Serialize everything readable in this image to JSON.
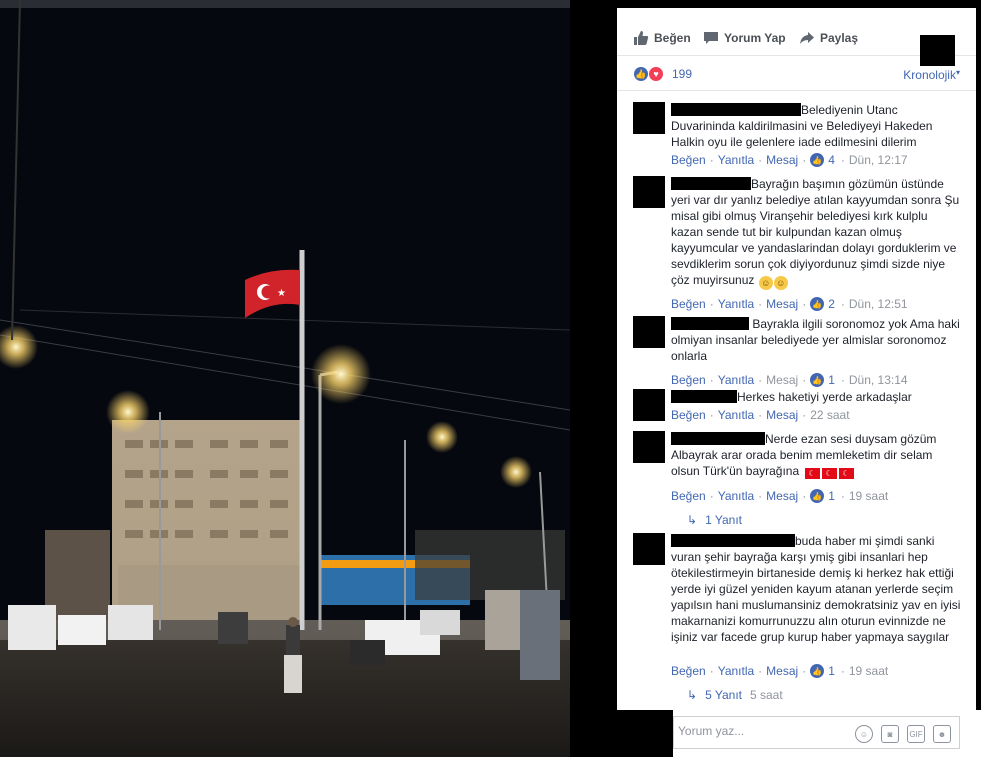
{
  "post": {
    "actions": [
      {
        "label": "Beğen",
        "icon": "thumbs-up-icon"
      },
      {
        "label": "Yorum Yap",
        "icon": "comment-icon"
      },
      {
        "label": "Paylaş",
        "icon": "share-icon"
      }
    ],
    "reaction_count": "199",
    "sort_label": "Kronolojik"
  },
  "comments": [
    {
      "text": "Belediyenin Utanc Duvarininda kaldirilmasini ve Belediyeyi Hakeden Halkin oyu ile gelenlere iade edilmesini dilerim",
      "like": "Beğen",
      "reply": "Yanıtla",
      "message": "Mesaj",
      "likes": "4",
      "time": "Dün, 12:17"
    },
    {
      "text": "Bayrağın başımın gözümün üstünde yeri var dır yanlız belediye atılan kayyumdan sonra Şu misal gibi olmuş Viranşehir belediyesi kırk kulplu kazan sende tut bir kulpundan kazan olmuş kayyumcular ve yandaslarindan dolayı gorduklerim ve sevdiklerim sorun çok diyiyordunuz şimdi sizde niye çöz muyirsunuz",
      "like": "Beğen",
      "reply": "Yanıtla",
      "message": "Mesaj",
      "likes": "2",
      "time": "Dün, 12:51"
    },
    {
      "text": "Bayrakla ilgili soronomoz yok Ama haki olmiyan insanlar belediyede yer almislar soronomoz onlarla",
      "like": "Beğen",
      "reply": "Yanıtla",
      "message": "Mesaj",
      "likes": "1",
      "time": "Dün, 13:14"
    },
    {
      "text": "Herkes haketiyi yerde arkadaşlar",
      "like": "Beğen",
      "reply": "Yanıtla",
      "message": "Mesaj",
      "time": "22 saat"
    },
    {
      "text": "Nerde ezan sesi duysam gözüm Albayrak arar orada benim memleketim dir selam olsun Türk'ün bayrağına",
      "like": "Beğen",
      "reply": "Yanıtla",
      "message": "Mesaj",
      "likes": "1",
      "time": "19 saat",
      "replies": "1 Yanıt"
    },
    {
      "text": "buda haber mi şimdi sanki vuran şehir bayrağa karşı ymiş gibi insanlari hep ötekilestirmeyin birtaneside demiş ki herkez hak ettiği yerde iyi güzel yeniden kayum atanan yerlerde seçim yapılsın hani muslumansiniz demokratsiniz yav en iyisi makarnanizi komurrunuzzu alın oturun evinnizde ne işiniz var facede grup kurup haber yapmaya saygılar",
      "like": "Beğen",
      "reply": "Yanıtla",
      "message": "Mesaj",
      "likes": "1",
      "time": "19 saat",
      "replies": "5 Yanıt",
      "replies_time": "5 saat"
    }
  ],
  "composer": {
    "placeholder": "Yorum yaz...",
    "icons": [
      "emoji-icon",
      "camera-icon",
      "gif-icon",
      "sticker-icon"
    ]
  },
  "colors": {
    "accent": "#4267b2",
    "muted": "#90949c",
    "love": "#f33e58"
  }
}
